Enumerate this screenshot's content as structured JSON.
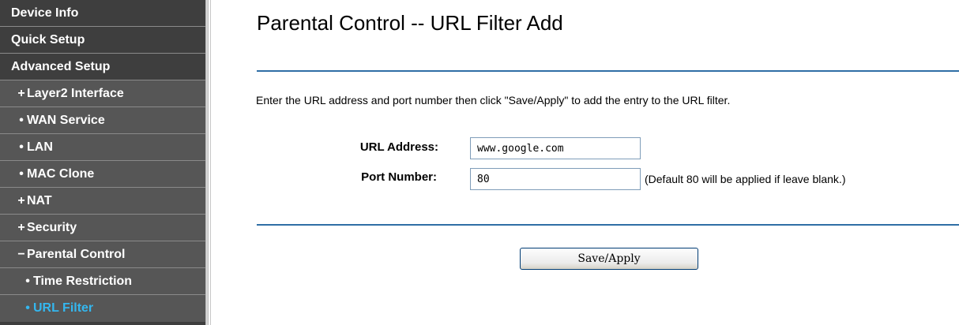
{
  "sidebar": {
    "items": [
      {
        "label": "Device Info",
        "marker": ""
      },
      {
        "label": "Quick Setup",
        "marker": ""
      },
      {
        "label": "Advanced Setup",
        "marker": ""
      },
      {
        "label": "Layer2 Interface",
        "marker": "+"
      },
      {
        "label": "WAN Service",
        "marker": "•"
      },
      {
        "label": "LAN",
        "marker": "•"
      },
      {
        "label": "MAC Clone",
        "marker": "•"
      },
      {
        "label": "NAT",
        "marker": "+"
      },
      {
        "label": "Security",
        "marker": "+"
      },
      {
        "label": "Parental Control",
        "marker": "−"
      },
      {
        "label": "Time Restriction",
        "marker": "•"
      },
      {
        "label": "URL Filter",
        "marker": "•"
      }
    ],
    "active_color": "#34b7ef"
  },
  "main": {
    "title": "Parental Control -- URL Filter Add",
    "instructions": "Enter the URL address and port number then click \"Save/Apply\" to add the entry to the URL filter.",
    "url_address": {
      "label": "URL Address:",
      "value": "www.google.com"
    },
    "port_number": {
      "label": "Port Number:",
      "value": "80",
      "hint": "(Default 80 will be applied if leave blank.)"
    },
    "save_label": "Save/Apply"
  },
  "colors": {
    "sidebar_bg": "#3e3e3e",
    "sidebar_sub_bg": "#565656",
    "rule": "#2f6ea5"
  }
}
